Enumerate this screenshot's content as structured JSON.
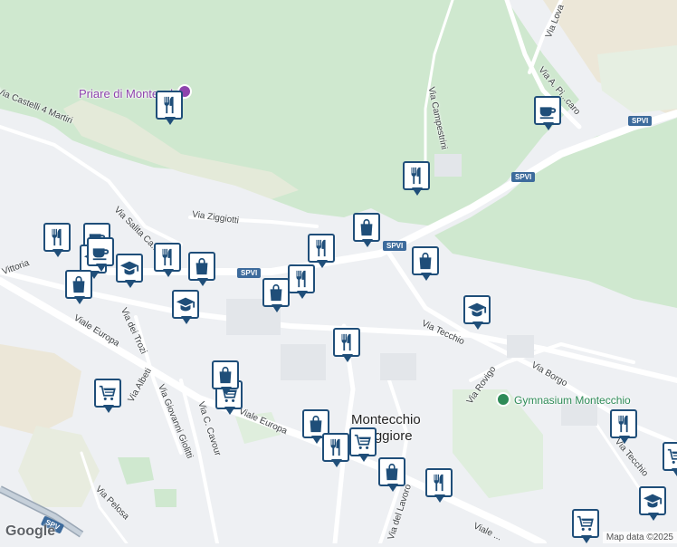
{
  "map": {
    "places": [
      {
        "id": "montecchio",
        "lines": [
          "Montecchio",
          "Maggiore"
        ]
      }
    ],
    "pois": [
      {
        "id": "priare",
        "label": "Priare di Montecchio",
        "style": "purple"
      },
      {
        "id": "gymnasium",
        "label": "Gymnasium Montecchio",
        "style": "green"
      }
    ],
    "roads": [
      {
        "id": "via-lova",
        "label": "Via Lova"
      },
      {
        "id": "via-a-pi",
        "label": "Via A. Pi...caro"
      },
      {
        "id": "via-campestrini",
        "label": "Via Campestrini"
      },
      {
        "id": "via-castelli",
        "label": "Via Castelli 4 Martiri"
      },
      {
        "id": "via-ziggiotti",
        "label": "Via Ziggiotti"
      },
      {
        "id": "via-salita-ca",
        "label": "Via Salita Ca..."
      },
      {
        "id": "vittoria",
        "label": "Vittoria"
      },
      {
        "id": "viale-europa-1",
        "label": "Viale Europa"
      },
      {
        "id": "via-dei-trozi",
        "label": "Via dei Trozi"
      },
      {
        "id": "via-albeti",
        "label": "Via Albeti"
      },
      {
        "id": "via-giovanni-giolitti",
        "label": "Via Giovanni Giolitti"
      },
      {
        "id": "via-c-cavour",
        "label": "Via C. Cavour"
      },
      {
        "id": "viale-europa-2",
        "label": "Viale Europa"
      },
      {
        "id": "via-tecchio",
        "label": "Via Tecchio"
      },
      {
        "id": "via-borgo",
        "label": "Via Borgo"
      },
      {
        "id": "via-rovigo",
        "label": "Via Rovigo"
      },
      {
        "id": "via-pelosa",
        "label": "Via Pelosa"
      },
      {
        "id": "via-del-lavoro",
        "label": "Via del Lavoro"
      },
      {
        "id": "viale-bottom",
        "label": "Viale ..."
      },
      {
        "id": "via-tecchio-2",
        "label": "Via Tecchio"
      }
    ],
    "shields": [
      {
        "id": "spvi-1",
        "label": "SPVI"
      },
      {
        "id": "spvi-2",
        "label": "SPVI"
      },
      {
        "id": "spvi-3",
        "label": "SPVI"
      },
      {
        "id": "spvi-4",
        "label": "SPVI"
      },
      {
        "id": "spv-5",
        "label": "SPV"
      }
    ],
    "markers": [
      {
        "type": "restaurant"
      },
      {
        "type": "cafe"
      },
      {
        "type": "restaurant"
      },
      {
        "type": "shop"
      },
      {
        "type": "restaurant"
      },
      {
        "type": "restaurant"
      },
      {
        "type": "cafe"
      },
      {
        "type": "school"
      },
      {
        "type": "school"
      },
      {
        "type": "shop"
      },
      {
        "type": "shop"
      },
      {
        "type": "school"
      },
      {
        "type": "restaurant"
      },
      {
        "type": "restaurant"
      },
      {
        "type": "shop"
      },
      {
        "type": "shop"
      },
      {
        "type": "school"
      },
      {
        "type": "restaurant"
      },
      {
        "type": "supermarket"
      },
      {
        "type": "supermarket"
      },
      {
        "type": "shop"
      },
      {
        "type": "supermarket"
      },
      {
        "type": "shop"
      },
      {
        "type": "supermarket"
      },
      {
        "type": "restaurant"
      },
      {
        "type": "shop"
      },
      {
        "type": "restaurant"
      },
      {
        "type": "restaurant"
      },
      {
        "type": "cafe"
      },
      {
        "type": "school"
      },
      {
        "type": "supermarket"
      }
    ]
  },
  "footer": {
    "logo": "Google",
    "copyright": "Map data ©2025"
  }
}
